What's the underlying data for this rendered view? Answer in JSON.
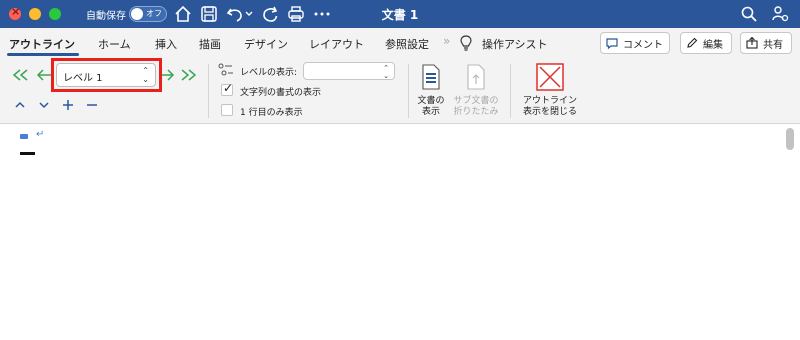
{
  "titlebar": {
    "autosave_label": "自動保存",
    "autosave_toggle": "オフ",
    "doc_title": "文書 1",
    "icons": [
      "home-icon",
      "save-icon",
      "undo-icon",
      "chevron-down-icon",
      "redo-icon",
      "print-icon",
      "more-icon",
      "search-icon",
      "share-people-icon"
    ]
  },
  "tabs": [
    {
      "label": "アウトライン",
      "active": true
    },
    {
      "label": "ホーム"
    },
    {
      "label": "挿入"
    },
    {
      "label": "描画"
    },
    {
      "label": "デザイン"
    },
    {
      "label": "レイアウト"
    },
    {
      "label": "参照設定"
    },
    {
      "label": "操作アシスト"
    }
  ],
  "tab_actions": {
    "comment": "コメント",
    "edit": "編集",
    "share": "共有"
  },
  "ribbon": {
    "level_select": "レベル 1",
    "display_level_label": "レベルの表示:",
    "display_level_value": "",
    "show_formatting_label": "文字列の書式の表示",
    "show_formatting_checked": true,
    "first_line_only_label": "1 行目のみ表示",
    "first_line_only_checked": false,
    "show_document": {
      "line1": "文書の",
      "line2": "表示"
    },
    "collapse_subdocs": {
      "line1": "サブ文書の",
      "line2": "折りたたみ"
    },
    "close_outline": {
      "line1": "アウトライン",
      "line2": "表示を閉じる"
    }
  },
  "colors": {
    "titlebar": "#2b579a",
    "highlight": "#e8221a",
    "outline_arrow": "#3aa655",
    "close_outline": "#e0302a"
  }
}
